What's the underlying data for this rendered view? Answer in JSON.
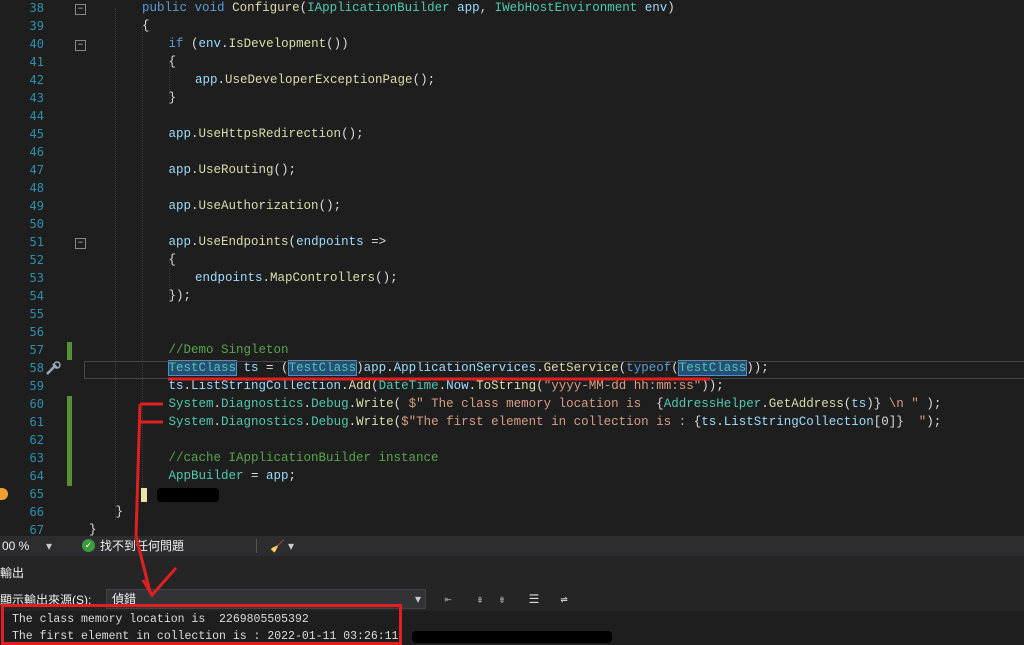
{
  "editor": {
    "lines": [
      {
        "n": "38",
        "html": "<span class=\"kw\">public</span> <span class=\"kw\">void</span> <span class=\"me\">Configure</span>(<span class=\"ty\">IApplicationBuilder</span> <span class=\"vr\">app</span>, <span class=\"ty\">IWebHostEnvironment</span> <span class=\"vr\">env</span>)",
        "indent": 0
      },
      {
        "n": "39",
        "html": "{",
        "indent": 0
      },
      {
        "n": "40",
        "html": "<span class=\"kw\">if</span> (<span class=\"vr\">env</span>.<span class=\"me\">IsDevelopment</span>())",
        "indent": 1
      },
      {
        "n": "41",
        "html": "{",
        "indent": 1
      },
      {
        "n": "42",
        "html": "<span class=\"vr\">app</span>.<span class=\"me\">UseDeveloperExceptionPage</span>();",
        "indent": 2
      },
      {
        "n": "43",
        "html": "}",
        "indent": 1
      },
      {
        "n": "44",
        "html": "",
        "indent": 0
      },
      {
        "n": "45",
        "html": "<span class=\"vr\">app</span>.<span class=\"me\">UseHttpsRedirection</span>();",
        "indent": 1
      },
      {
        "n": "46",
        "html": "",
        "indent": 0
      },
      {
        "n": "47",
        "html": "<span class=\"vr\">app</span>.<span class=\"me\">UseRouting</span>();",
        "indent": 1
      },
      {
        "n": "48",
        "html": "",
        "indent": 0
      },
      {
        "n": "49",
        "html": "<span class=\"vr\">app</span>.<span class=\"me\">UseAuthorization</span>();",
        "indent": 1
      },
      {
        "n": "50",
        "html": "",
        "indent": 0
      },
      {
        "n": "51",
        "html": "<span class=\"vr\">app</span>.<span class=\"me\">UseEndpoints</span>(<span class=\"vr\">endpoints</span> =>",
        "indent": 1
      },
      {
        "n": "52",
        "html": "{",
        "indent": 1
      },
      {
        "n": "53",
        "html": "<span class=\"vr\">endpoints</span>.<span class=\"me\">MapControllers</span>();",
        "indent": 2
      },
      {
        "n": "54",
        "html": "});",
        "indent": 1
      },
      {
        "n": "55",
        "html": "",
        "indent": 0
      },
      {
        "n": "56",
        "html": "",
        "indent": 0
      },
      {
        "n": "57",
        "html": "<span class=\"cm\">//Demo Singleton</span>",
        "indent": 1
      },
      {
        "n": "58",
        "html": "<span class=\"ty hl\">TestClass</span> <span class=\"vr\">ts</span> = (<span class=\"ty hl\">TestClass</span>)<span class=\"vr\">app</span>.<span class=\"vr\">ApplicationServices</span>.<span class=\"me\">GetService</span>(<span class=\"kw\">typeof</span>(<span class=\"ty hl\">TestClass</span>));",
        "indent": 1
      },
      {
        "n": "59",
        "html": "<span class=\"vr\">ts</span>.<span class=\"vr\">ListStringCollection</span>.<span class=\"me\">Add</span>(<span class=\"ty\">DateTime</span>.<span class=\"vr\">Now</span>.<span class=\"me\">ToString</span>(<span class=\"st\">\"yyyy-MM-dd hh:mm:ss\"</span>));",
        "indent": 1
      },
      {
        "n": "60",
        "html": "<span class=\"ty\">System</span>.<span class=\"ty\">Diagnostics</span>.<span class=\"ty\">Debug</span>.<span class=\"me\">Write</span>( <span class=\"st\">$\" The class memory location is  </span>{<span class=\"ty\">AddressHelper</span>.<span class=\"me\">GetAddress</span>(<span class=\"vr\">ts</span>)}<span class=\"st\"> \\n \"</span> );",
        "indent": 1
      },
      {
        "n": "61",
        "html": "<span class=\"ty\">System</span>.<span class=\"ty\">Diagnostics</span>.<span class=\"ty\">Debug</span>.<span class=\"me\">Write</span>(<span class=\"st\">$\"The first element in collection is : </span>{<span class=\"vr\">ts</span>.<span class=\"vr\">ListStringCollection</span>[0]}<span class=\"st\">  \"</span>);",
        "indent": 1
      },
      {
        "n": "62",
        "html": "",
        "indent": 0
      },
      {
        "n": "63",
        "html": "<span class=\"cm\">//cache IApplicationBuilder instance</span>",
        "indent": 1
      },
      {
        "n": "64",
        "html": "<span class=\"ty\">AppBuilder</span> = <span class=\"vr\">app</span>;",
        "indent": 1
      },
      {
        "n": "65",
        "html": "",
        "indent": 0
      },
      {
        "n": "66",
        "html": "}",
        "indent": -1
      },
      {
        "n": "67",
        "html": "}",
        "indent": -2
      }
    ]
  },
  "statusbar": {
    "zoom": "00 %",
    "zoom_caret": "▾",
    "issues": "找不到任何問題",
    "tool_caret": "▾"
  },
  "output": {
    "title": "輸出",
    "source_label": "顯示輸出來源(S):",
    "source_value": "偵錯",
    "lines": [
      "The class memory location is  2269805505392",
      "The first element in collection is : 2022-01-11 03:26:11"
    ]
  },
  "colors": {
    "annotation_red": "#e02020",
    "line_number": "#2b91af",
    "change_bar": "#5a8f3a"
  },
  "icons": {
    "ok": "check-circle-icon",
    "lightbulb": "quick-action-icon",
    "breakpoint": "breakpoint-icon"
  }
}
